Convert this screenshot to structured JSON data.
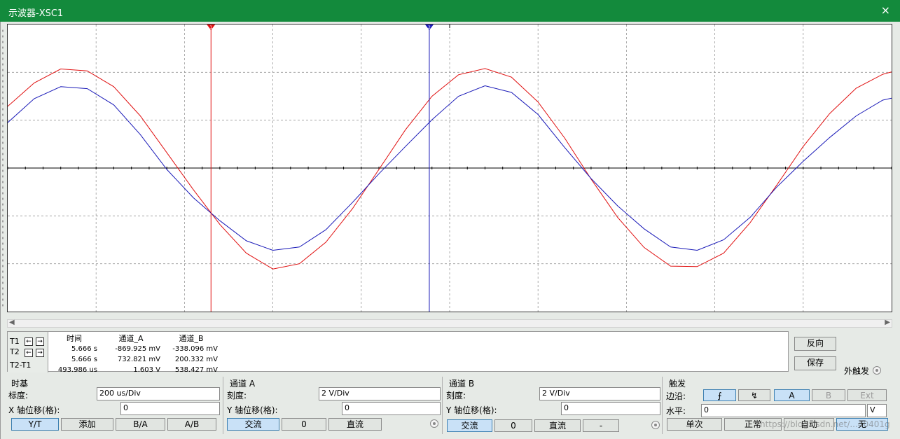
{
  "window": {
    "title": "示波器-XSC1",
    "close_icon": "×"
  },
  "colors": {
    "channel_a": "#e01010",
    "channel_b": "#1a1ab8",
    "cursor_t1": "#e01010",
    "cursor_t2": "#1a1ab8",
    "titlebar": "#138a3c"
  },
  "cursors": {
    "t1_marker": "1",
    "t2_marker": "2",
    "t1_position_div": 2.3,
    "t2_position_div": 4.77
  },
  "readout": {
    "headers": [
      "时间",
      "通道_A",
      "通道_B"
    ],
    "rows": [
      {
        "label": "T1",
        "time": "5.666 s",
        "ch_a": "-869.925 mV",
        "ch_b": "-338.096 mV"
      },
      {
        "label": "T2",
        "time": "5.666 s",
        "ch_a": "732.821 mV",
        "ch_b": "200.332 mV"
      },
      {
        "label": "T2-T1",
        "time": "493.986 us",
        "ch_a": "1.603 V",
        "ch_b": "538.427 mV"
      }
    ],
    "arrow_left": "←",
    "arrow_right": "→"
  },
  "side_buttons": {
    "reverse": "反向",
    "save": "保存",
    "ext_trigger": "外触发"
  },
  "timebase": {
    "group_label": "时基",
    "scale_label": "标度:",
    "scale_value": "200 us/Div",
    "x_offset_label": "X 轴位移(格):",
    "x_offset_value": "0",
    "modes": [
      "Y/T",
      "添加",
      "B/A",
      "A/B"
    ],
    "active_mode": "Y/T"
  },
  "channel_a": {
    "group_label": "通道 A",
    "scale_label": "刻度:",
    "scale_value": "2  V/Div",
    "y_offset_label": "Y 轴位移(格):",
    "y_offset_value": "0",
    "coupling": [
      "交流",
      "0",
      "直流"
    ],
    "active_coupling": "交流"
  },
  "channel_b": {
    "group_label": "通道 B",
    "scale_label": "刻度:",
    "scale_value": "2  V/Div",
    "y_offset_label": "Y 轴位移(格):",
    "y_offset_value": "0",
    "coupling": [
      "交流",
      "0",
      "直流",
      "-"
    ],
    "active_coupling": "交流"
  },
  "trigger": {
    "group_label": "触发",
    "edge_label": "边沿:",
    "edge_rising": "⨍",
    "edge_falling": "↯",
    "sources": [
      "A",
      "B",
      "Ext"
    ],
    "active_source": "A",
    "level_label": "水平:",
    "level_value": "0",
    "level_unit": "V",
    "modes": [
      "单次",
      "正常",
      "自动",
      "无"
    ],
    "active_mode": "无"
  },
  "watermark": "https://blog.csdn.net/...40401g",
  "chart_data": {
    "type": "line",
    "x_divisions": 10,
    "y_divisions": 6,
    "x": [
      0,
      0.3,
      0.6,
      0.9,
      1.2,
      1.5,
      1.8,
      2.1,
      2.4,
      2.7,
      3.0,
      3.3,
      3.6,
      3.9,
      4.2,
      4.5,
      4.8,
      5.1,
      5.4,
      5.7,
      6.0,
      6.3,
      6.6,
      6.9,
      7.2,
      7.5,
      7.8,
      8.1,
      8.4,
      8.7,
      9.0,
      9.3,
      9.6,
      9.9,
      10.0
    ],
    "series": [
      {
        "channel": "A",
        "values": [
          1.29,
          1.78,
          2.07,
          2.03,
          1.7,
          1.09,
          0.32,
          -0.45,
          -1.18,
          -1.78,
          -2.11,
          -2.0,
          -1.55,
          -0.85,
          -0.03,
          0.8,
          1.5,
          1.95,
          2.08,
          1.9,
          1.38,
          0.63,
          -0.23,
          -1.03,
          -1.66,
          -2.05,
          -2.06,
          -1.78,
          -1.14,
          -0.36,
          0.45,
          1.14,
          1.67,
          1.96,
          2.01
        ]
      },
      {
        "channel": "B",
        "values": [
          0.95,
          1.45,
          1.7,
          1.66,
          1.32,
          0.7,
          -0.03,
          -0.62,
          -1.1,
          -1.52,
          -1.72,
          -1.65,
          -1.29,
          -0.72,
          -0.12,
          0.45,
          1.01,
          1.5,
          1.72,
          1.58,
          1.12,
          0.43,
          -0.22,
          -0.79,
          -1.27,
          -1.65,
          -1.72,
          -1.5,
          -1.03,
          -0.4,
          0.14,
          0.64,
          1.09,
          1.42,
          1.46
        ]
      }
    ],
    "xlim": [
      0,
      10
    ],
    "ylim": [
      -3,
      3
    ],
    "grid": true
  }
}
